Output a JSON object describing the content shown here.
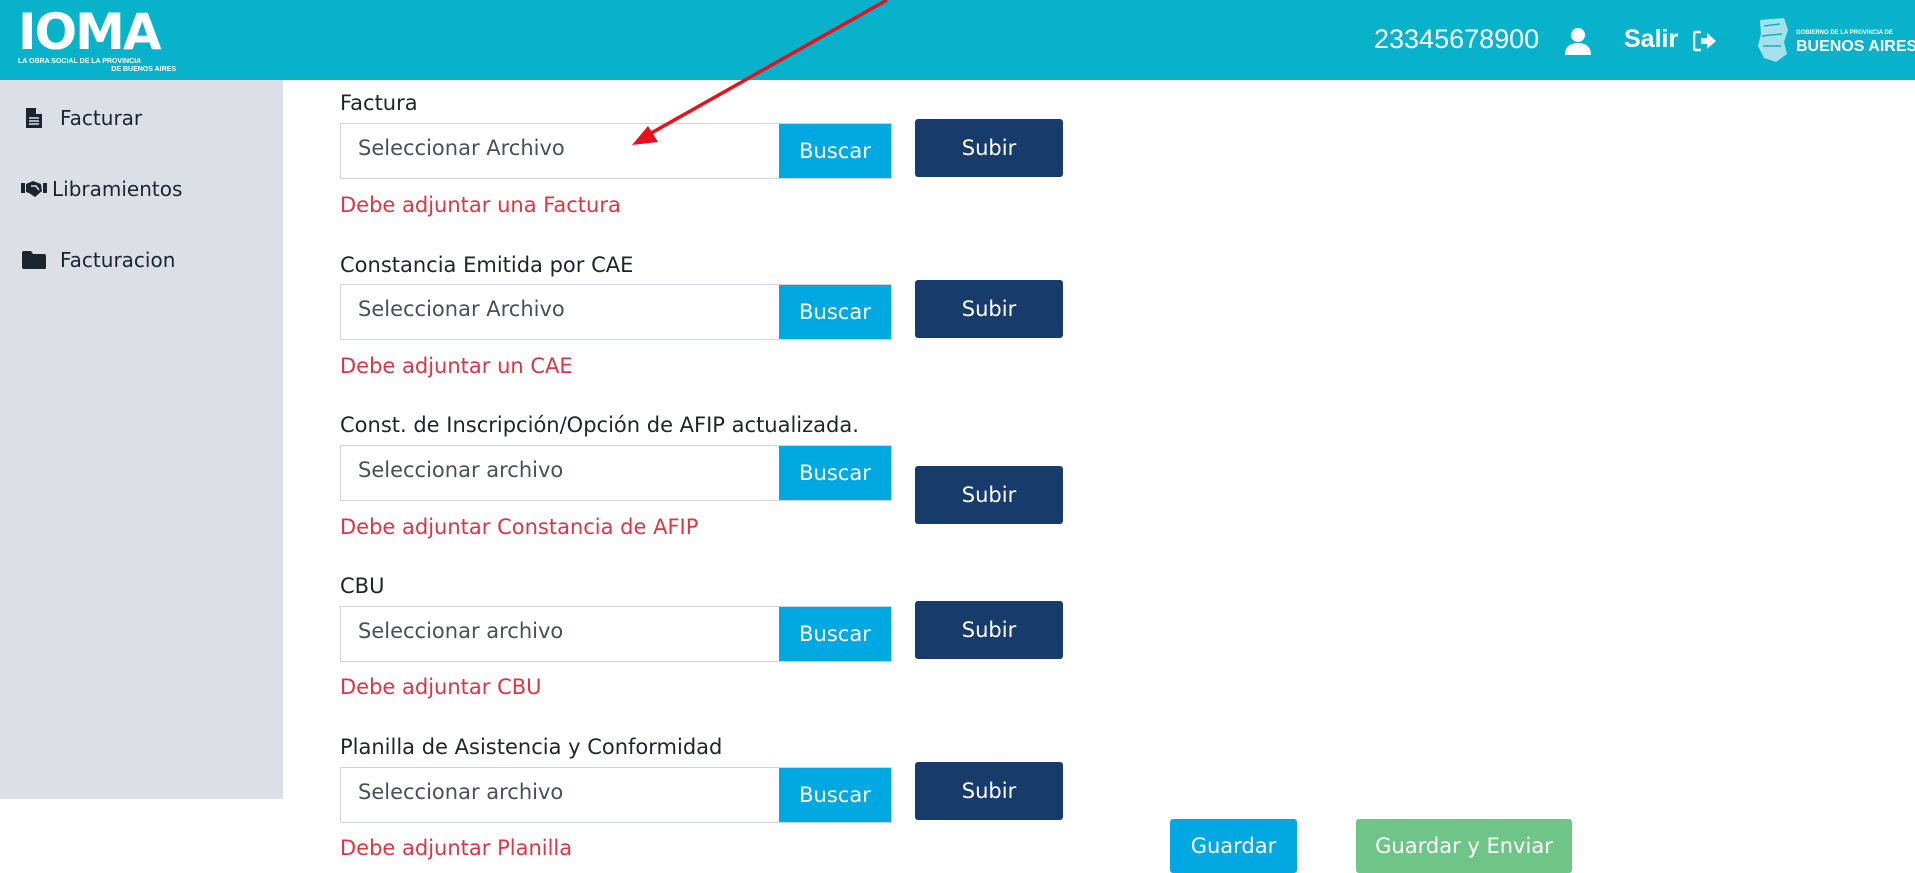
{
  "header": {
    "logo_main": "IOMA",
    "logo_sub_line1": "LA OBRA SOCIAL DE LA PROVINCIA",
    "logo_sub_line2": "DE BUENOS AIRES",
    "user_id": "23345678900",
    "user_icon": "user-icon",
    "logout_label": "Salir",
    "logout_icon": "sign-out-icon",
    "province_logo_top": "GOBIERNO DE LA PROVINCIA DE",
    "province_logo_bottom": "BUENOS AIRES"
  },
  "sidebar": {
    "items": [
      {
        "label": "Facturar",
        "icon": "file-icon"
      },
      {
        "label": "Libramientos",
        "icon": "handshake-icon"
      },
      {
        "label": "Facturacion",
        "icon": "folder-icon"
      }
    ]
  },
  "form": {
    "fields": [
      {
        "label": "Factura",
        "placeholder": "Seleccionar Archivo",
        "browse": "Buscar",
        "upload": "Subir",
        "error": "Debe adjuntar una Factura"
      },
      {
        "label": "Constancia Emitida por CAE",
        "placeholder": "Seleccionar Archivo",
        "browse": "Buscar",
        "upload": "Subir",
        "error": "Debe adjuntar un CAE"
      },
      {
        "label": "Const. de Inscripción/Opción de AFIP actualizada.",
        "placeholder": "Seleccionar archivo",
        "browse": "Buscar",
        "upload": "Subir",
        "error": "Debe adjuntar Constancia de AFIP"
      },
      {
        "label": "CBU",
        "placeholder": "Seleccionar archivo",
        "browse": "Buscar",
        "upload": "Subir",
        "error": "Debe adjuntar CBU"
      },
      {
        "label": "Planilla de Asistencia y Conformidad",
        "placeholder": "Seleccionar archivo",
        "browse": "Buscar",
        "upload": "Subir",
        "error": "Debe adjuntar Planilla"
      }
    ],
    "save_label": "Guardar",
    "save_send_label": "Guardar y Enviar"
  },
  "colors": {
    "header_bg": "#08b2cb",
    "sidebar_bg": "#dcdfe6",
    "browse_bg": "#00a8e1",
    "upload_bg": "#173b6b",
    "error_text": "#dc3545",
    "save_send_bg": "#6fc587",
    "annotation_arrow": "#e8101a"
  }
}
